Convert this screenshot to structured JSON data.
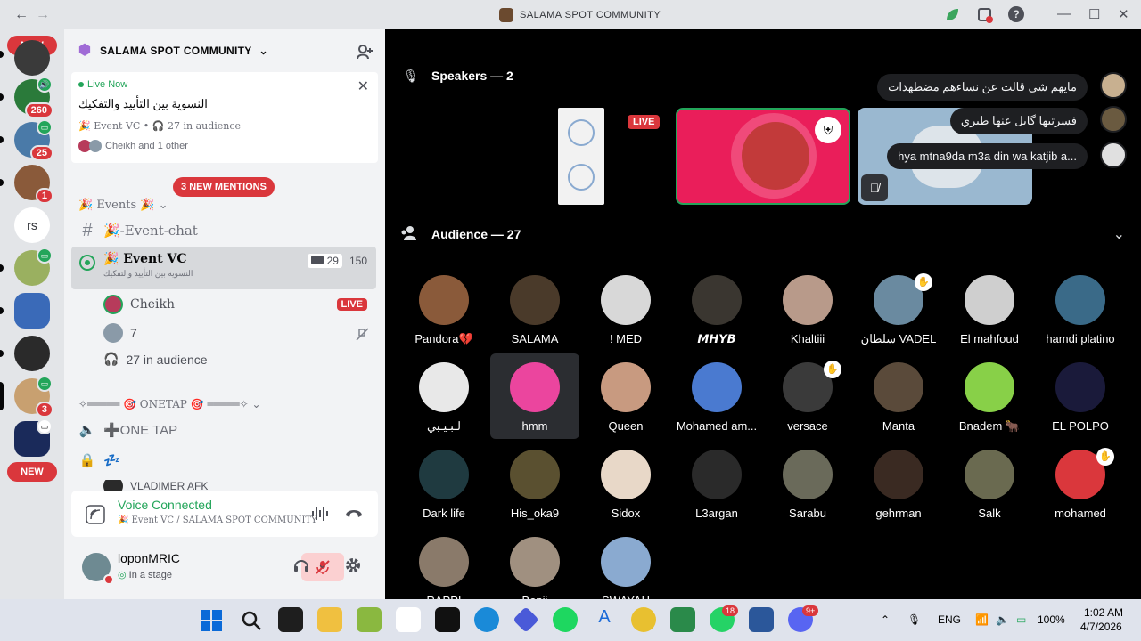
{
  "window": {
    "title": "SALAMA SPOT COMMUNITY",
    "back": "←",
    "forward": "→",
    "help": "?",
    "minimize": "—",
    "maximize": "☐",
    "close": "✕"
  },
  "guilds": {
    "new_top": "NEW",
    "new_bottom": "NEW",
    "badge_260": "260",
    "badge_25": "25",
    "badge_1": "1",
    "text_server": "rs",
    "badge_3": "3"
  },
  "server": {
    "name": "SALAMA SPOT COMMUNITY",
    "chevron": "⌄"
  },
  "live_card": {
    "status": "Live Now",
    "topic": "النسوية بين التأييد والتفكيك",
    "channel_meta": "🎉 Event VC • 🎧 27 in audience",
    "hosts": "Cheikh and 1 other"
  },
  "mentions": "3 NEW MENTIONS",
  "channels": {
    "events_category": "🎉 Events 🎉 ⌄",
    "event_chat": "🎉-Event-chat",
    "event_vc": "🎉 Event VC",
    "event_vc_topic": "النسوية بين التأييد والتفكيك",
    "vc_cam_count": "29",
    "vc_user_count": "150",
    "member_cheikh": "Cheikh",
    "member_live": "LIVE",
    "member_7": "7",
    "audience": "27 in audience",
    "onetap_category": "✧═════ 🎯 ONETAP 🎯 ═════✧ ⌄",
    "onetap_channel": "➕ONE TAP",
    "locked_channel": "💤",
    "partial_member": "VLADIMER AFK"
  },
  "voice": {
    "title": "Voice Connected",
    "subtitle": "🎉 Event VC / SALAMA SPOT COMMUNITY"
  },
  "user": {
    "name": "loponMRIC",
    "status": "In a stage"
  },
  "stage": {
    "speakers_title": "Speakers — 2",
    "live_label": "LIVE",
    "audience_title": "Audience — 27",
    "chat": [
      {
        "text": "مايهم شي قالت عن نساءهم مضطهدات"
      },
      {
        "text": "فسرتيها گايل عنها طبري"
      },
      {
        "text": "hya mtna9da m3a din wa katjib a..."
      }
    ],
    "audience": [
      {
        "name": "Pandora💔",
        "color": "#8a5a3a"
      },
      {
        "name": "SALAMA",
        "color": "#4a3a2a"
      },
      {
        "name": "! MED",
        "color": "#d8d8d8"
      },
      {
        "name": "𝙈𝙃𝙔𝘽",
        "color": "#3a3630"
      },
      {
        "name": "Khaltiii",
        "color": "#b89a8a"
      },
      {
        "name": "سلطان VADEL",
        "color": "#6a8aa0"
      },
      {
        "name": "El mahfoud",
        "color": "#cfcfcf"
      },
      {
        "name": "hamdi platino",
        "color": "#3a6a88"
      },
      {
        "name": "لـبـيـبي",
        "color": "#e8e8e8"
      },
      {
        "name": "hmm",
        "color": "#eb459e"
      },
      {
        "name": "Queen",
        "color": "#c89a80"
      },
      {
        "name": "Mohamed am...",
        "color": "#4a7ad0"
      },
      {
        "name": "versace",
        "color": "#3a3a3a"
      },
      {
        "name": "Manta",
        "color": "#5a4a3a"
      },
      {
        "name": "Bnadem 🐂",
        "color": "#88d048"
      },
      {
        "name": "EL POLPO",
        "color": "#1a1a3a"
      },
      {
        "name": "Dark life",
        "color": "#1f3a40"
      },
      {
        "name": "His_oka9",
        "color": "#5a5030"
      },
      {
        "name": "Sidox",
        "color": "#e8d8c8"
      },
      {
        "name": "L3argan",
        "color": "#2a2a2a"
      },
      {
        "name": "Sarabu",
        "color": "#6a6a5a"
      },
      {
        "name": "gehrman",
        "color": "#3a2a22"
      },
      {
        "name": "Salk",
        "color": "#6a6a50"
      },
      {
        "name": "mohamed",
        "color": "#da373c"
      },
      {
        "name": "RAPPI",
        "color": "#8a7a6a"
      },
      {
        "name": "Benji",
        "color": "#a09080"
      },
      {
        "name": "SWAYAH",
        "color": "#8aaad0"
      }
    ]
  },
  "taskbar": {
    "lang": "ENG",
    "battery": "100%",
    "time": "1:02 AM",
    "date": "4/7/2026",
    "whatsapp_badge": "18",
    "discord_badge": "9+"
  }
}
